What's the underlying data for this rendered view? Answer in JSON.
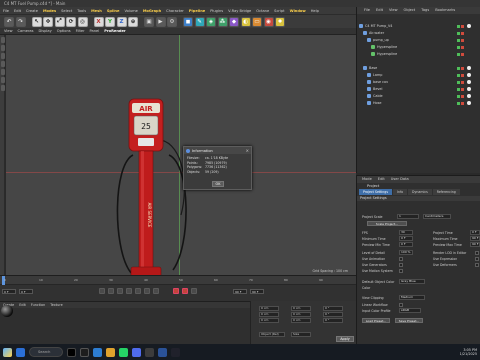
{
  "window": {
    "title": "C4 MT Fuel Pump.c4d *] - Main"
  },
  "menubar": [
    {
      "label": "File"
    },
    {
      "label": "Edit"
    },
    {
      "label": "Create"
    },
    {
      "label": "Modes"
    },
    {
      "label": "Select"
    },
    {
      "label": "Tools"
    },
    {
      "label": "Mesh"
    },
    {
      "label": "Spline"
    },
    {
      "label": "Volume"
    },
    {
      "label": "MoGraph"
    },
    {
      "label": "Character"
    },
    {
      "label": "Pipeline"
    },
    {
      "label": "Plugins"
    },
    {
      "label": "V-Ray Bridge"
    },
    {
      "label": "Octane"
    },
    {
      "label": "Script"
    },
    {
      "label": "Window"
    },
    {
      "label": "Help"
    }
  ],
  "toolbar": {
    "buttons": [
      "undo",
      "redo",
      "live-select",
      "move",
      "scale",
      "rotate",
      "last-tool",
      "X",
      "Y",
      "Z",
      "world-coords",
      "render-region",
      "render-view",
      "render-settings",
      "cube",
      "pen",
      "subdivision",
      "array",
      "extrude",
      "deformer",
      "floor",
      "camera",
      "light"
    ]
  },
  "viewport_menu": [
    {
      "label": "View"
    },
    {
      "label": "Cameras"
    },
    {
      "label": "Display"
    },
    {
      "label": "Options"
    },
    {
      "label": "Filter"
    },
    {
      "label": "Panel"
    },
    {
      "label": "ProRender"
    }
  ],
  "viewport": {
    "grid_spacing": "Grid Spacing : 100 cm",
    "pump_top_label": "AIR",
    "pump_counter": "25"
  },
  "dialog": {
    "title": "Information",
    "close": "×",
    "rows": [
      {
        "k": "Filesize:",
        "v": "ca. 1'18 KByte"
      },
      {
        "k": "Points:",
        "v": "7985 (10979)"
      },
      {
        "k": "Polygons:",
        "v": "7736 (11362)"
      },
      {
        "k": "Objects:",
        "v": "59 (209)"
      }
    ],
    "ok": "OK"
  },
  "timeline": {
    "ticks": [
      "0",
      "10",
      "20",
      "30",
      "40",
      "50",
      "60",
      "70",
      "80",
      "90"
    ],
    "start_field": "0 F",
    "current_field": "0 F",
    "end_field": "90 F",
    "end_field2": "90 F"
  },
  "materials": {
    "menu": [
      {
        "label": "Create"
      },
      {
        "label": "Edit"
      },
      {
        "label": "Function"
      },
      {
        "label": "Texture"
      }
    ]
  },
  "coordinates": {
    "fields": [
      "0 cm",
      "0 cm",
      "0 cm",
      "0 cm",
      "0 cm",
      "0 cm",
      "0 °",
      "0 °",
      "0 °"
    ],
    "mode_left": "Object (Rel)",
    "mode_mid": "Size",
    "apply": "Apply"
  },
  "object_manager": {
    "menu": [
      {
        "label": "File"
      },
      {
        "label": "Edit"
      },
      {
        "label": "View"
      },
      {
        "label": "Object"
      },
      {
        "label": "Tags"
      },
      {
        "label": "Bookmarks"
      }
    ],
    "objects": [
      {
        "name": "C4 MT Pump_V4",
        "level": 0,
        "color": "#8ab4f0"
      },
      {
        "name": "Air.water",
        "level": 1,
        "color": "#8ab4f0"
      },
      {
        "name": "pump_up",
        "level": 2,
        "color": "#8ab4f0"
      },
      {
        "name": "Hyperspline",
        "level": 3,
        "color": "#8ab4f0"
      },
      {
        "name": "Hyperspline",
        "level": 3,
        "color": "#8ab4f0"
      },
      {
        "name": "Base",
        "level": 1,
        "color": "#8ab4f0"
      },
      {
        "name": "Lamp",
        "level": 2,
        "color": "#8ab4f0"
      },
      {
        "name": "base cov",
        "level": 2,
        "color": "#8ab4f0"
      },
      {
        "name": "Bevel",
        "level": 2,
        "color": "#8ab4f0"
      },
      {
        "name": "Cable",
        "level": 2,
        "color": "#8ab4f0"
      },
      {
        "name": "Hose",
        "level": 2,
        "color": "#8ab4f0"
      }
    ]
  },
  "attribute_manager": {
    "menu": [
      {
        "label": "Mode"
      },
      {
        "label": "Edit"
      },
      {
        "label": "User Data"
      }
    ],
    "header": "Project",
    "tabs": [
      {
        "label": "Project Settings",
        "active": true
      },
      {
        "label": "Info",
        "active": false
      },
      {
        "label": "Dynamics",
        "active": false
      },
      {
        "label": "Referencing",
        "active": false
      }
    ],
    "section": "Project Settings",
    "scale_label": "Project Scale",
    "scale_value": "1",
    "scale_unit": "Centimeters",
    "scale_button": "Scale Project...",
    "fps_label": "FPS",
    "fps_value": "30",
    "project_time_label": "Project Time",
    "project_time_value": "0 F",
    "min_time_label": "Minimum Time",
    "min_time_value": "0 F",
    "max_time_label": "Maximum Time",
    "max_time_value": "90 F",
    "prev_min_label": "Preview Min Time",
    "prev_min_value": "0 F",
    "prev_max_label": "Preview Max Time",
    "prev_max_value": "90 F",
    "lod_label": "Level of Detail",
    "lod_value": "100 %",
    "render_lod_label": "Render LOD in Editor",
    "use_anim": "Use Animation",
    "use_expr": "Use Expression",
    "use_gen": "Use Generators",
    "use_deform": "Use Deformers",
    "use_motion": "Use Motion System",
    "default_color_label": "Default Object Color",
    "default_color_value": "Gray Blue",
    "color_label": "Color",
    "view_clip_label": "View Clipping",
    "view_clip_value": "Medium",
    "linear_label": "Linear Workflow",
    "input_color_label": "Input Color Profile",
    "input_color_value": "sRGB",
    "load_preset": "Load Preset...",
    "save_preset": "Save Preset..."
  },
  "taskbar": {
    "search": "Search",
    "time": "3:05 PM",
    "date": "1/21/2025"
  }
}
